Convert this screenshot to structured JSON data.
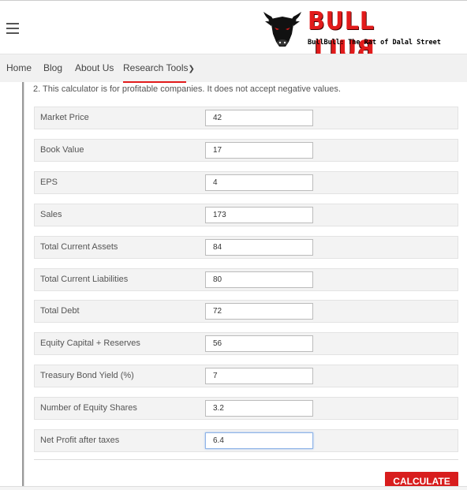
{
  "brand": {
    "name_part1": "BULL",
    "name_part2_mirrored": "BULL",
    "tagline": "BullBull: The Rat of Dalal Street"
  },
  "nav": {
    "items": [
      "Home",
      "Blog",
      "About Us",
      "Research Tools"
    ],
    "chevron": "❯",
    "active": "Research Tools"
  },
  "note": "2. This calculator is for profitable companies. It does not accept negative values.",
  "form": {
    "fields": [
      {
        "label": "Market Price",
        "value": "42"
      },
      {
        "label": "Book Value",
        "value": "17"
      },
      {
        "label": "EPS",
        "value": "4"
      },
      {
        "label": "Sales",
        "value": "173"
      },
      {
        "label": "Total Current Assets",
        "value": "84"
      },
      {
        "label": "Total Current Liabilities",
        "value": "80"
      },
      {
        "label": "Total Debt",
        "value": "72"
      },
      {
        "label": "Equity Capital + Reserves",
        "value": "56"
      },
      {
        "label": "Treasury Bond Yield (%)",
        "value": "7"
      },
      {
        "label": "Number of Equity Shares",
        "value": "3.2"
      },
      {
        "label": "Net Profit after taxes",
        "value": "6.4"
      }
    ],
    "focused_field": "Net Profit after taxes"
  },
  "calculate_label": "CALCULATE",
  "colors": {
    "accent": "#e21b1b",
    "button": "#d81d1d",
    "row_bg": "#f3f3f3",
    "nav_bg": "#f1f1f1"
  }
}
